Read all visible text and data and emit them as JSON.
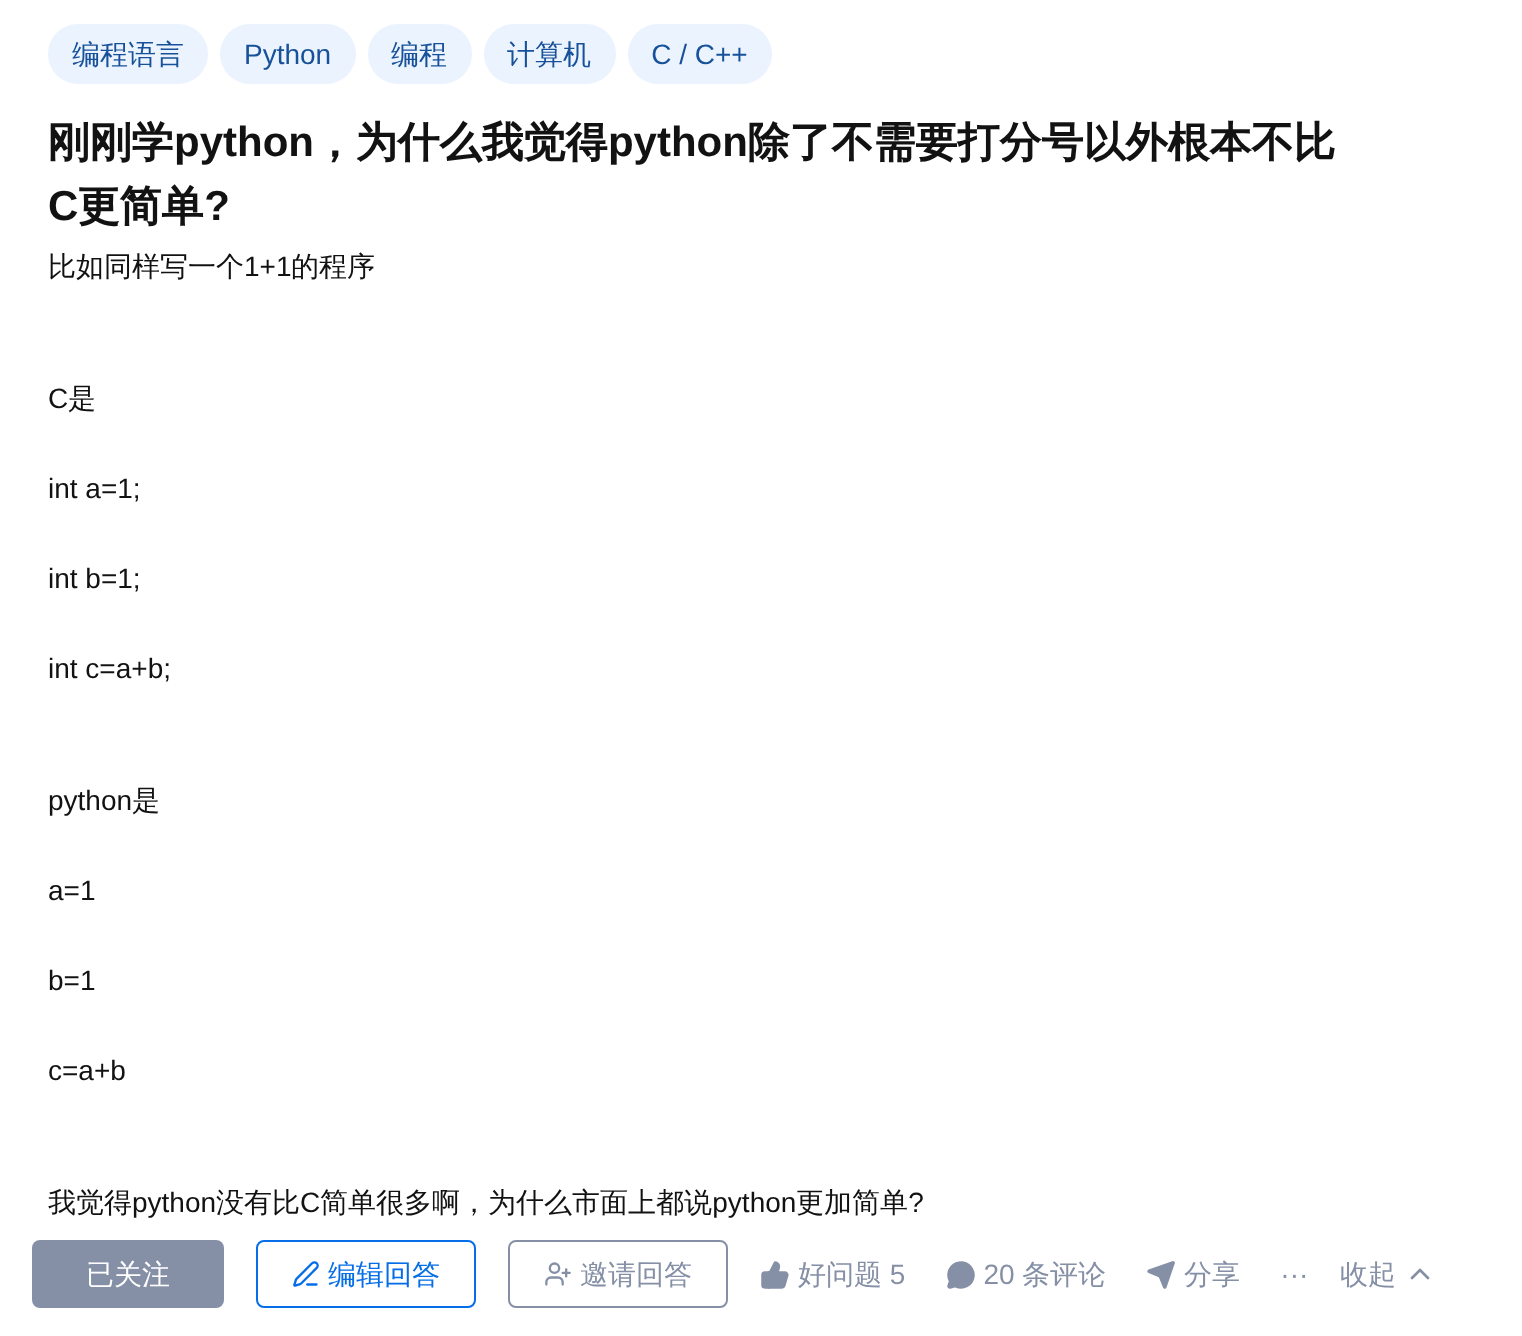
{
  "tags": [
    "编程语言",
    "Python",
    "编程",
    "计算机",
    "C / C++"
  ],
  "title": "刚刚学python，为什么我觉得python除了不需要打分号以外根本不比C更简单?",
  "blocks": [
    [
      "比如同样写一个1+1的程序"
    ],
    [
      "C是",
      "int a=1;",
      "int b=1;",
      "int c=a+b;"
    ],
    [
      "python是",
      "a=1",
      "b=1",
      "c=a+b"
    ],
    [
      "我觉得python没有比C简单很多啊，为什么市面上都说python更加简单?"
    ]
  ],
  "actions": {
    "follow": {
      "label": "已关注",
      "selected": true
    },
    "edit": "编辑回答",
    "invite": "邀请回答",
    "good_question": "好问题 5",
    "comments": "20 条评论",
    "share": "分享",
    "more": "···",
    "collapse": "收起"
  }
}
